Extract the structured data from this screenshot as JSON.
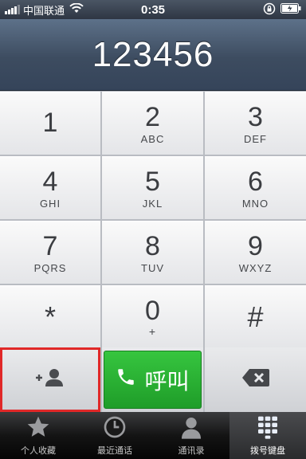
{
  "status": {
    "carrier": "中国联通",
    "time": "0:35"
  },
  "dialer": {
    "number": "123456"
  },
  "keys": [
    {
      "digit": "1",
      "letters": ""
    },
    {
      "digit": "2",
      "letters": "ABC"
    },
    {
      "digit": "3",
      "letters": "DEF"
    },
    {
      "digit": "4",
      "letters": "GHI"
    },
    {
      "digit": "5",
      "letters": "JKL"
    },
    {
      "digit": "6",
      "letters": "MNO"
    },
    {
      "digit": "7",
      "letters": "PQRS"
    },
    {
      "digit": "8",
      "letters": "TUV"
    },
    {
      "digit": "9",
      "letters": "WXYZ"
    },
    {
      "digit": "*",
      "letters": ""
    },
    {
      "digit": "0",
      "letters": "+"
    },
    {
      "digit": "#",
      "letters": ""
    }
  ],
  "actions": {
    "add_contact_icon": "add-contact-icon",
    "call_label": "呼叫",
    "call_icon": "phone-icon",
    "delete_icon": "backspace-icon",
    "call_color": "#2bb335"
  },
  "tabs": [
    {
      "label": "个人收藏",
      "icon": "star-icon"
    },
    {
      "label": "最近通话",
      "icon": "clock-icon"
    },
    {
      "label": "通讯录",
      "icon": "contacts-icon"
    },
    {
      "label": "拨号键盘",
      "icon": "keypad-icon"
    }
  ]
}
